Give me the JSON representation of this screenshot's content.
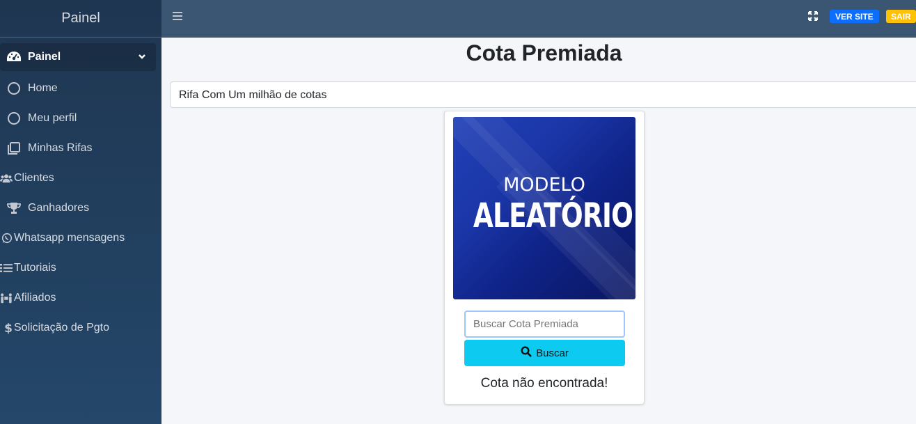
{
  "sidebar": {
    "brand": "Painel",
    "items": [
      {
        "label": "Painel",
        "icon": "dashboard-icon"
      },
      {
        "label": "Home",
        "icon": "circle-icon"
      },
      {
        "label": "Meu perfil",
        "icon": "circle-icon"
      },
      {
        "label": "Minhas Rifas",
        "icon": "copy-icon"
      },
      {
        "label": "Clientes",
        "icon": "users-icon"
      },
      {
        "label": "Ganhadores",
        "icon": "trophy-icon"
      },
      {
        "label": "Whatsapp mensagens",
        "icon": "whatsapp-icon"
      },
      {
        "label": "Tutoriais",
        "icon": "list-icon"
      },
      {
        "label": "Afiliados",
        "icon": "people-carry-icon"
      },
      {
        "label": "Solicitação de Pgto",
        "icon": "dollar-icon"
      }
    ]
  },
  "topbar": {
    "ver_site": "VER SITE",
    "sair": "SAIR"
  },
  "main": {
    "title_light": "Cota",
    "title_bold": "Premiada",
    "selected_rifa": "Rifa Com Um milhão de cotas",
    "banner_line1": "MODELO",
    "banner_line2": "ALEATÓRIO",
    "search_placeholder": "Buscar Cota Premiada",
    "search_button": "Buscar",
    "result": "Cota não encontrada!"
  },
  "colors": {
    "sidebar": "#24476a",
    "topbar": "#3b5673",
    "ver_site": "#0d6efd",
    "sair": "#ffc107",
    "buscar": "#0dcaf0"
  }
}
